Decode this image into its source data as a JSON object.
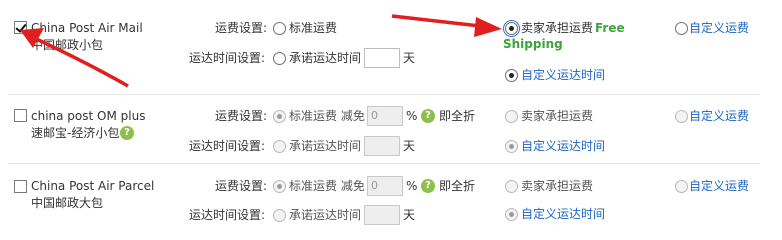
{
  "rows": [
    {
      "name_en": "China Post Air Mail",
      "name_cn": "中国邮政小包",
      "shipping_label": "运费设置:",
      "opt_standard": "标准运费",
      "opt_seller": "卖家承担运费",
      "free_shipping": "Free Shipping",
      "opt_custom": "自定义运费",
      "time_label": "运达时间设置:",
      "opt_promised_time": "承诺运达时间",
      "days_unit": "天",
      "opt_custom_time": "自定义运达时间"
    },
    {
      "name_en": "china post OM plus",
      "name_cn": "速邮宝-经济小包",
      "shipping_label": "运费设置:",
      "opt_standard": "标准运费 减免",
      "discount_value": "0",
      "percent": "%",
      "full_discount": "即全折",
      "opt_seller": "卖家承担运费",
      "opt_custom": "自定义运费",
      "time_label": "运达时间设置:",
      "opt_promised_time": "承诺运达时间",
      "days_unit": "天",
      "opt_custom_time": "自定义运达时间"
    },
    {
      "name_en": "China Post Air Parcel",
      "name_cn": "中国邮政大包",
      "shipping_label": "运费设置:",
      "opt_standard": "标准运费 减免",
      "discount_value": "0",
      "percent": "%",
      "full_discount": "即全折",
      "opt_seller": "卖家承担运费",
      "opt_custom": "自定义运费",
      "time_label": "运达时间设置:",
      "opt_promised_time": "承诺运达时间",
      "days_unit": "天",
      "opt_custom_time": "自定义运达时间"
    }
  ],
  "colors": {
    "link": "#1c66c2",
    "free_shipping": "#3da33b",
    "annotation_arrow": "#e02020",
    "help_icon": "#8dbf4b"
  },
  "icons": {
    "help": "question-circle-icon",
    "annotation": "red-arrow-annotation"
  },
  "help_glyph": "?"
}
